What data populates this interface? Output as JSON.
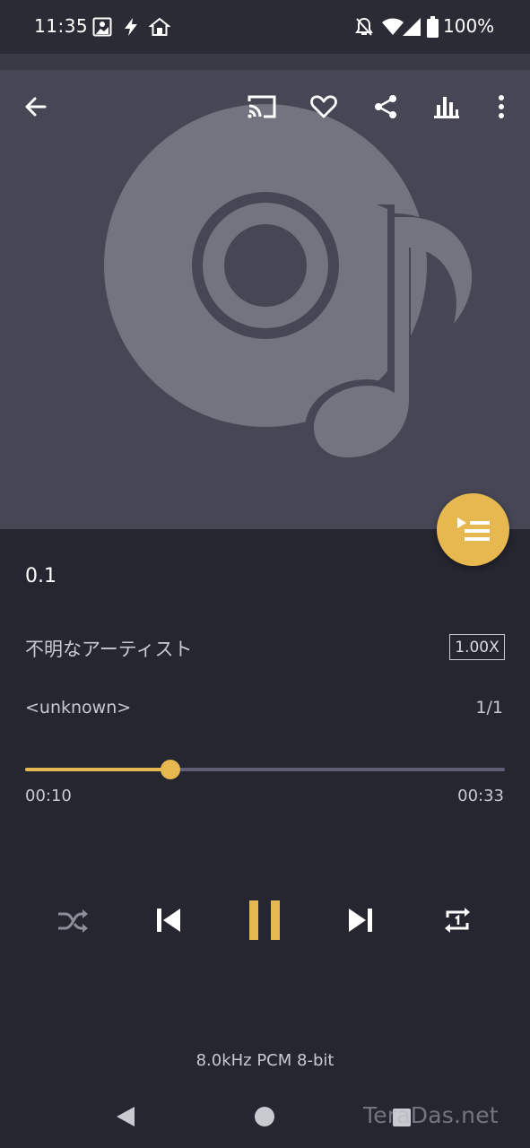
{
  "status_bar": {
    "time": "11:35",
    "battery": "100%",
    "icons": [
      "screenshot-icon",
      "flash-icon",
      "home-icon",
      "dnd-off-icon",
      "wifi-icon",
      "signal-icon",
      "battery-icon"
    ]
  },
  "toolbar": {
    "icons": [
      "back-arrow-icon",
      "cast-icon",
      "heart-icon",
      "share-icon",
      "equalizer-icon",
      "more-vert-icon"
    ]
  },
  "artwork": {
    "icon": "music-disc-icon"
  },
  "track": {
    "title": "0.1",
    "artist": "不明なアーティスト",
    "album": "<unknown>",
    "index": "1/1",
    "speed": "1.00X"
  },
  "playback": {
    "elapsed": "00:10",
    "total": "00:33",
    "progress": 0.303
  },
  "controls": {
    "icons": [
      "shuffle-icon",
      "skip-previous-icon",
      "pause-icon",
      "skip-next-icon",
      "repeat-one-icon"
    ]
  },
  "format_info": "8.0kHz PCM 8-bit",
  "nav_bar": {
    "icons": [
      "nav-back-icon",
      "nav-home-icon",
      "nav-recents-icon"
    ]
  },
  "watermark": "TeraDas.net",
  "colors": {
    "accent": "#e7b84f",
    "background": "#262631",
    "artwork_bg": "#464654",
    "artwork_fg": "#747480",
    "text_secondary": "#c9c9d0"
  }
}
